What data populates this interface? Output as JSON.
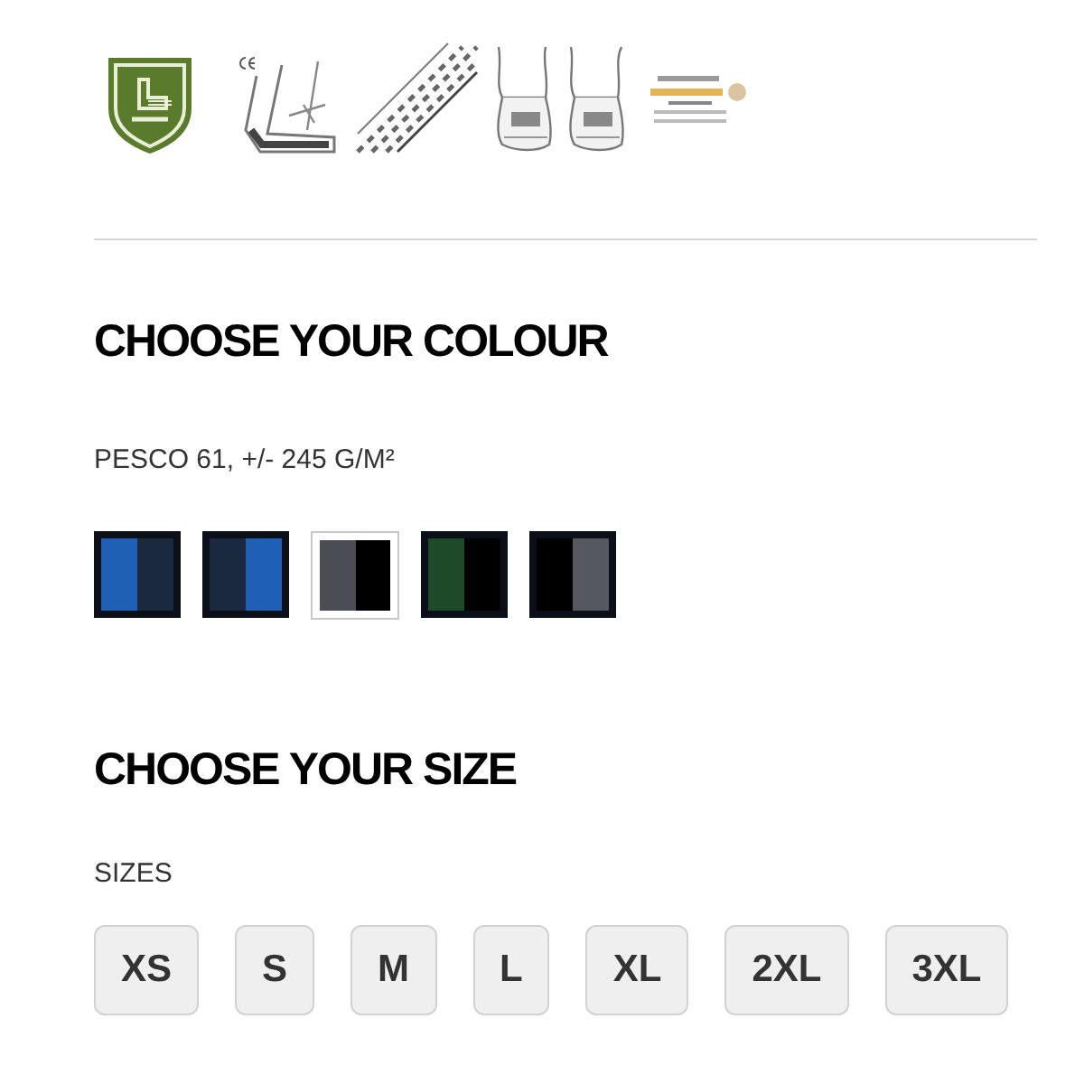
{
  "colour_section": {
    "title": "CHOOSE YOUR COLOUR",
    "material": "PESCO 61, +/- 245 G/M²",
    "swatches": [
      {
        "halves": [
          {
            "color": "#1f5fb5"
          },
          {
            "color": "#1b2940"
          }
        ],
        "selected": false
      },
      {
        "halves": [
          {
            "color": "#1b2940"
          },
          {
            "color": "#1f5fb5"
          }
        ],
        "selected": false
      },
      {
        "halves": [
          {
            "color": "#4a4d55"
          },
          {
            "color": "#000000"
          }
        ],
        "selected": true
      },
      {
        "halves": [
          {
            "color": "#1e4a2a"
          },
          {
            "color": "#000000"
          }
        ],
        "selected": false
      },
      {
        "halves": [
          {
            "color": "#000000"
          },
          {
            "color": "#55585f"
          }
        ],
        "selected": false
      }
    ]
  },
  "size_section": {
    "title": "CHOOSE YOUR SIZE",
    "label": "SIZES",
    "sizes": [
      {
        "label": "XS",
        "selected": false
      },
      {
        "label": "S",
        "selected": false
      },
      {
        "label": "M",
        "selected": false
      },
      {
        "label": "L",
        "selected": false
      },
      {
        "label": "XL",
        "selected": false
      },
      {
        "label": "2XL",
        "selected": false
      },
      {
        "label": "3XL",
        "selected": false
      }
    ]
  }
}
